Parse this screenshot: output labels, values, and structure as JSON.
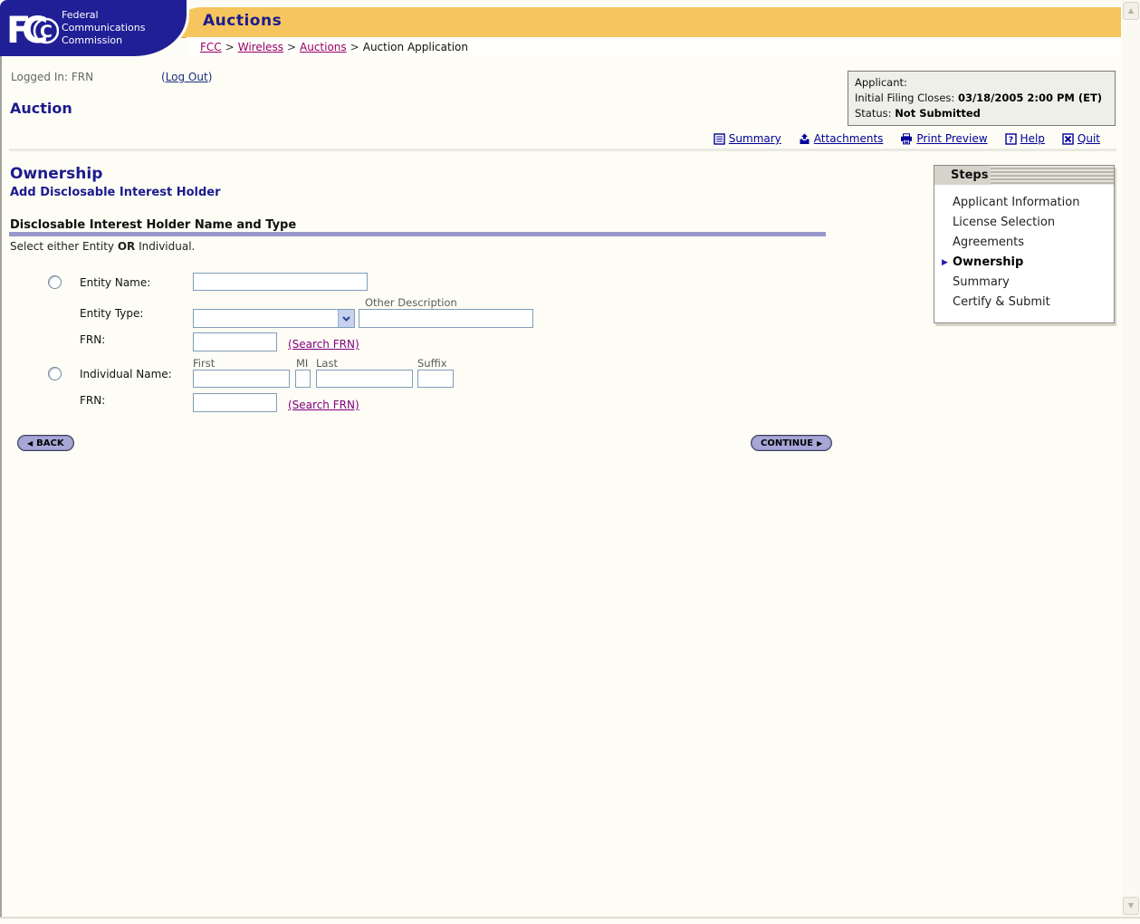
{
  "header": {
    "logo": {
      "letters": "FCC",
      "name_lines": [
        "Federal",
        "Communications",
        "Commission"
      ]
    },
    "app_title": "Auctions",
    "breadcrumb": {
      "separator": ">",
      "items": [
        {
          "label": "FCC"
        },
        {
          "label": "Wireless"
        },
        {
          "label": "Auctions"
        },
        {
          "label": "Auction Application"
        }
      ]
    }
  },
  "session": {
    "logged_in_text": "Logged In: FRN",
    "logout_prefix": "(",
    "logout_label": "Log Out",
    "logout_suffix": ")"
  },
  "page_title": "Auction",
  "applicant_box": {
    "line1_label": "Applicant:",
    "line2_label": "Initial Filing Closes: ",
    "line2_value": "03/18/2005 2:00 PM (ET)",
    "line3_label": "Status: ",
    "line3_value": "Not Submitted"
  },
  "toolbar": [
    {
      "label": "Summary",
      "icon": "summary-icon"
    },
    {
      "label": "Attachments",
      "icon": "attachments-icon"
    },
    {
      "label": "Print Preview",
      "icon": "print-preview-icon"
    },
    {
      "label": "Help",
      "icon": "help-icon"
    },
    {
      "label": "Quit",
      "icon": "quit-icon"
    }
  ],
  "ownership": {
    "title": "Ownership",
    "subtitle": "Add Disclosable Interest Holder",
    "section_title": "Disclosable Interest Holder Name and Type",
    "instruction_pre": "Select either Entity ",
    "instruction_bold": "OR",
    "instruction_post": " Individual."
  },
  "form": {
    "entity": {
      "name_label": "Entity Name:",
      "type_label": "Entity Type:",
      "other_description_label": "Other Description",
      "frn_label": "FRN:",
      "search_frn_label": "(Search FRN)"
    },
    "individual": {
      "name_label": "Individual Name:",
      "first_label": "First",
      "mi_label": "MI",
      "last_label": "Last",
      "suffix_label": "Suffix",
      "frn_label": "FRN:",
      "search_frn_label": "(Search FRN)"
    },
    "values": {
      "entity_name": "",
      "entity_type": "",
      "other_description": "",
      "entity_frn": "",
      "first_name": "",
      "mi": "",
      "last_name": "",
      "suffix": "",
      "individual_frn": ""
    }
  },
  "buttons": {
    "back_label": "BACK",
    "back_arrow": "◀",
    "continue_label": "CONTINUE",
    "continue_arrow": "▶"
  },
  "steps": {
    "title": "Steps",
    "active_arrow": "▶",
    "items": [
      {
        "label": "Applicant Information",
        "active": false
      },
      {
        "label": "License Selection",
        "active": false
      },
      {
        "label": "Agreements",
        "active": false
      },
      {
        "label": "Ownership",
        "active": true
      },
      {
        "label": "Summary",
        "active": false
      },
      {
        "label": "Certify & Submit",
        "active": false
      }
    ]
  },
  "colors": {
    "banner_yellow": "#F6C55E",
    "fcc_navy": "#201F96",
    "heading_navy": "#1B1B8F",
    "toolbar_link": "#000099",
    "breadcrumb_link": "#990066",
    "search_link": "#800080",
    "section_rule": "#9898CC",
    "button_fill": "#A7A7D7",
    "input_border": "#7F9DB9"
  }
}
